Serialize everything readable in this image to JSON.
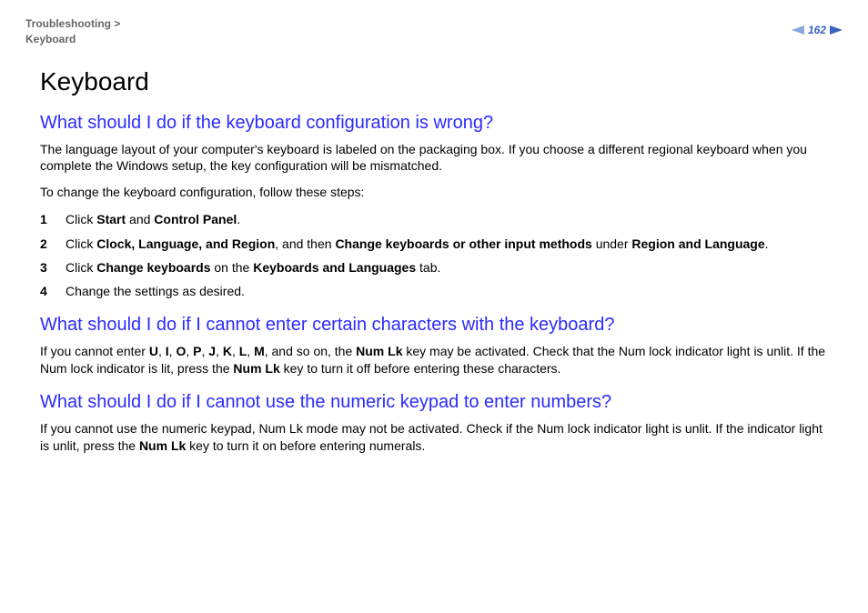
{
  "breadcrumb": {
    "line1": "Troubleshooting >",
    "line2": "Keyboard"
  },
  "page_number": "162",
  "title": "Keyboard",
  "sections": [
    {
      "heading": "What should I do if the keyboard configuration is wrong?",
      "paragraphs": [
        "The language layout of your computer's keyboard is labeled on the packaging box. If you choose a different regional keyboard when you complete the Windows setup, the key configuration will be mismatched.",
        "To change the keyboard configuration, follow these steps:"
      ],
      "steps": [
        {
          "n": "1",
          "html": "Click <b>Start</b> and <b>Control Panel</b>."
        },
        {
          "n": "2",
          "html": "Click <b>Clock, Language, and Region</b>, and then <b>Change keyboards or other input methods</b> under <b>Region and Language</b>."
        },
        {
          "n": "3",
          "html": "Click <b>Change keyboards</b> on the <b>Keyboards and Languages</b> tab."
        },
        {
          "n": "4",
          "html": "Change the settings as desired."
        }
      ]
    },
    {
      "heading": "What should I do if I cannot enter certain characters with the keyboard?",
      "paragraphs_html": [
        "If you cannot enter <b>U</b>, <b>I</b>, <b>O</b>, <b>P</b>, <b>J</b>, <b>K</b>, <b>L</b>, <b>M</b>, and so on, the <b>Num Lk</b> key may be activated. Check that the Num lock indicator light is unlit. If the Num lock indicator is lit, press the <b>Num Lk</b> key to turn it off before entering these characters."
      ]
    },
    {
      "heading": "What should I do if I cannot use the numeric keypad to enter numbers?",
      "paragraphs_html": [
        "If you cannot use the numeric keypad, Num Lk mode may not be activated. Check if the Num lock indicator light is unlit. If the indicator light is unlit, press the <b>Num Lk</b> key to turn it on before entering numerals."
      ]
    }
  ]
}
